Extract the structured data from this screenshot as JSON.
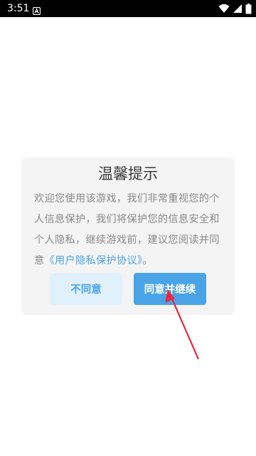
{
  "status_bar": {
    "time": "3:51",
    "notification_icon": "a-square-icon",
    "icons": [
      "wifi-icon",
      "cellular-signal-icon",
      "battery-icon"
    ]
  },
  "dialog": {
    "title": "温馨提示",
    "body_text": "欢迎您使用该游戏，我们非常重视您的个人信息保护，我们将保护您的信息安全和个人隐私，继续游戏前，建议您阅读并同意",
    "link_text": "《用户隐私保护协议》",
    "body_end": "。",
    "disagree_label": "不同意",
    "agree_label": "同意并继续"
  },
  "colors": {
    "accent": "#4aa3e6",
    "disagree_bg": "#e1f1fb",
    "dialog_bg": "#f4f4f4",
    "annotation_arrow": "#e8283c"
  }
}
